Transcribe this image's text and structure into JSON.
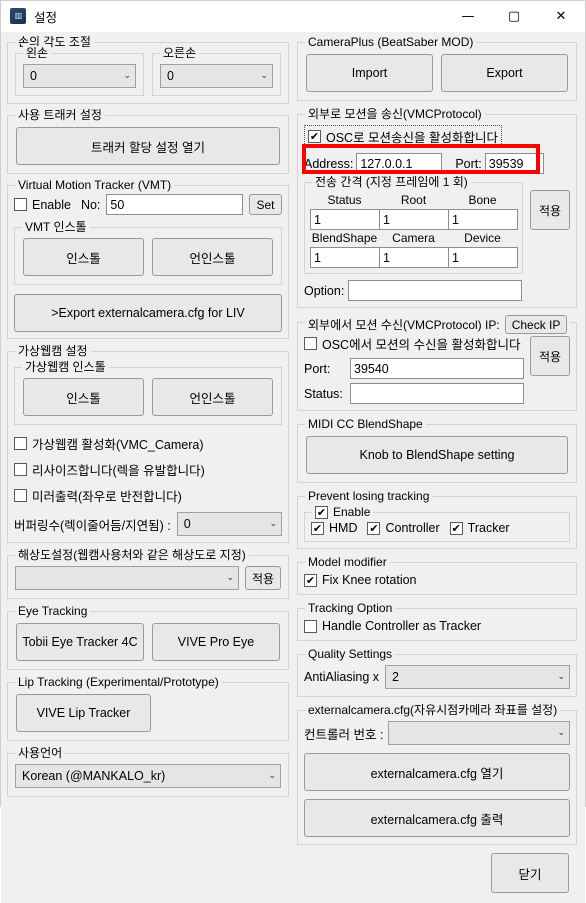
{
  "window": {
    "title": "설정",
    "icon": "app-icon",
    "minimize": "—",
    "maximize": "▢",
    "close": "✕"
  },
  "left": {
    "hand_angle": {
      "title": "손의 각도 조절",
      "left_hand": {
        "label": "왼손",
        "value": "0"
      },
      "right_hand": {
        "label": "오른손",
        "value": "0"
      }
    },
    "tracker_settings": {
      "title": "사용 트래커 설정",
      "open_button": "트래커 할당 설정 열기"
    },
    "vmt": {
      "title": "Virtual Motion Tracker (VMT)",
      "enable_label": "Enable",
      "enable_checked": false,
      "no_label": "No:",
      "no_value": "50",
      "set_button": "Set",
      "install_group_title": "VMT 인스톨",
      "install_button": "인스톨",
      "uninstall_button": "언인스톨",
      "export_liv_button": ">Export externalcamera.cfg for LIV"
    },
    "webcam": {
      "title": "가상웹캠 설정",
      "install_group_title": "가상웹캠 인스톨",
      "install_button": "인스톨",
      "uninstall_button": "언인스톨",
      "enable_vmc_camera": "가상웹캠 활성화(VMC_Camera)",
      "enable_vmc_camera_checked": false,
      "resize": "리사이즈합니다(렉을 유발합니다)",
      "resize_checked": false,
      "mirror": "미러출력(좌우로 반전합니다)",
      "mirror_checked": false,
      "buffering_label": "버퍼링수(렉이줄어듬/지연됨) :",
      "buffering_value": "0",
      "resolution_group_title": "해상도설정(웹캠사용처와 같은 해상도로 지정)",
      "resolution_value": "",
      "resolution_apply": "적용"
    },
    "eye_tracking": {
      "title": "Eye Tracking",
      "tobii_button": "Tobii Eye Tracker 4C",
      "vive_button": "VIVE Pro Eye"
    },
    "lip_tracking": {
      "title": "Lip Tracking (Experimental/Prototype)",
      "vive_lip_button": "VIVE Lip Tracker"
    },
    "language": {
      "title": "사용언어",
      "value": "Korean (@MANKALO_kr)"
    }
  },
  "right": {
    "cameraplus": {
      "title": "CameraPlus (BeatSaber MOD)",
      "import_button": "Import",
      "export_button": "Export"
    },
    "send": {
      "title": "외부로 모션을 송신(VMCProtocol)",
      "osc_enable_label": "OSC로 모션송신을 활성화합니다",
      "osc_enable_checked": true,
      "address_label": "Address:",
      "address_value": "127.0.0.1",
      "port_label": "Port:",
      "port_value": "39539",
      "interval_title": "전송 간격 (지정 프레임에 1 회)",
      "interval_headers_row1": [
        "Status",
        "Root",
        "Bone"
      ],
      "interval_values_row1": [
        "1",
        "1",
        "1"
      ],
      "interval_headers_row2": [
        "BlendShape",
        "Camera",
        "Device"
      ],
      "interval_values_row2": [
        "1",
        "1",
        "1"
      ],
      "apply_button": "적용",
      "option_label": "Option:",
      "option_value": ""
    },
    "receive": {
      "title": "외부에서 모션 수신(VMCProtocol) IP:",
      "check_ip_button": "Check IP",
      "osc_receive_label": "OSC에서 모션의 수신을 활성화합니다",
      "osc_receive_checked": false,
      "port_label": "Port:",
      "port_value": "39540",
      "status_label": "Status:",
      "status_value": "",
      "apply_button": "적용"
    },
    "midi": {
      "title": "MIDI CC BlendShape",
      "knob_button": "Knob to BlendShape setting"
    },
    "prevent_losing": {
      "title": "Prevent losing tracking",
      "enable_label": "Enable",
      "enable_checked": true,
      "hmd_label": "HMD",
      "hmd_checked": true,
      "controller_label": "Controller",
      "controller_checked": true,
      "tracker_label": "Tracker",
      "tracker_checked": true
    },
    "model_modifier": {
      "title": "Model modifier",
      "fix_knee_label": "Fix Knee rotation",
      "fix_knee_checked": true
    },
    "tracking_option": {
      "title": "Tracking Option",
      "handle_controller_label": "Handle Controller as Tracker",
      "handle_controller_checked": false
    },
    "quality": {
      "title": "Quality Settings",
      "antialiasing_label": "AntiAliasing   x",
      "antialiasing_value": "2"
    },
    "externalcamera": {
      "title": "externalcamera.cfg(자유시점카메라 좌표를 설정)",
      "controller_no_label": "컨트롤러 번호 :",
      "controller_no_value": "",
      "open_button": "externalcamera.cfg 열기",
      "output_button": "externalcamera.cfg 출력"
    },
    "close_button": "닫기"
  },
  "annotation": {
    "highlight_color": "#ff0000",
    "highlight_target": "osc-send-enable-checkbox"
  },
  "glyphs": {
    "check": "✔",
    "chevron_down": "⌄"
  }
}
